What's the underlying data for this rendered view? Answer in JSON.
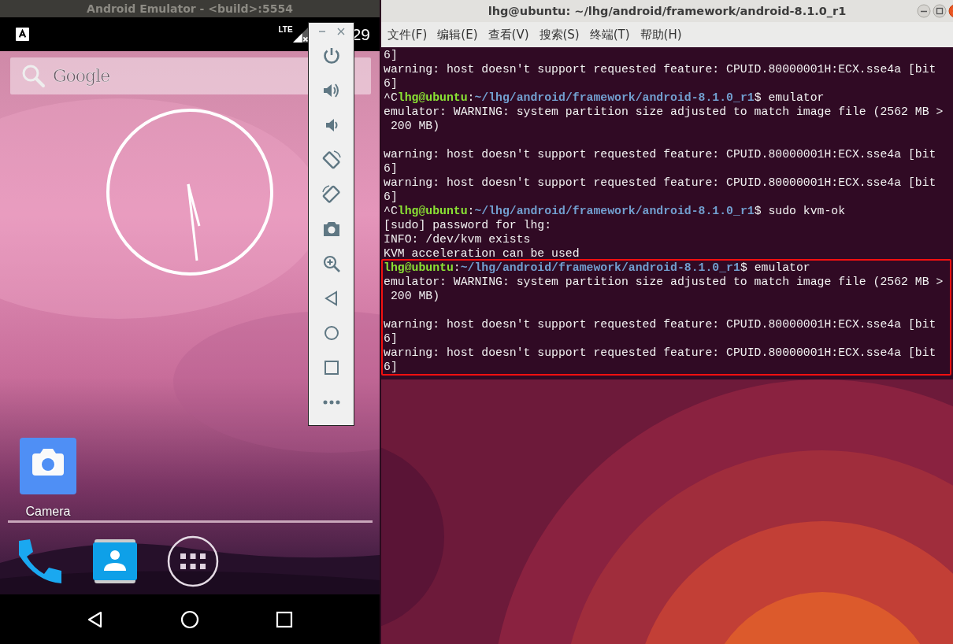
{
  "emulator": {
    "title": "Android Emulator - <build>:5554",
    "status_bar": {
      "network": "LTE",
      "time": "29"
    },
    "search": {
      "logo_text": "Google"
    },
    "apps": [
      {
        "label": "Camera"
      }
    ]
  },
  "terminal": {
    "title": "lhg@ubuntu: ~/lhg/android/framework/android-8.1.0_r1",
    "menu": [
      "文件(F)",
      "编辑(E)",
      "查看(V)",
      "搜索(S)",
      "终端(T)",
      "帮助(H)"
    ],
    "blocks": [
      {
        "highlighted": false,
        "lines": [
          {
            "kind": "output",
            "text": "6]"
          },
          {
            "kind": "output",
            "text": "warning: host doesn't support requested feature: CPUID.80000001H:ECX.sse4a [bit"
          },
          {
            "kind": "output",
            "text": "6]"
          },
          {
            "kind": "prompt",
            "prefix": "^C",
            "user": "lhg@ubuntu",
            "sep": ":",
            "path": "~/lhg/android/framework/android-8.1.0_r1",
            "command": "$ emulator"
          },
          {
            "kind": "output",
            "text": "emulator: WARNING: system partition size adjusted to match image file (2562 MB >"
          },
          {
            "kind": "output",
            "text": " 200 MB)"
          },
          {
            "kind": "blank"
          },
          {
            "kind": "output",
            "text": "warning: host doesn't support requested feature: CPUID.80000001H:ECX.sse4a [bit"
          },
          {
            "kind": "output",
            "text": "6]"
          },
          {
            "kind": "output",
            "text": "warning: host doesn't support requested feature: CPUID.80000001H:ECX.sse4a [bit"
          },
          {
            "kind": "output",
            "text": "6]"
          },
          {
            "kind": "prompt",
            "prefix": "^C",
            "user": "lhg@ubuntu",
            "sep": ":",
            "path": "~/lhg/android/framework/android-8.1.0_r1",
            "command": "$ sudo kvm-ok"
          },
          {
            "kind": "output",
            "text": "[sudo] password for lhg:"
          },
          {
            "kind": "output",
            "text": "INFO: /dev/kvm exists"
          },
          {
            "kind": "output",
            "text": "KVM acceleration can be used"
          }
        ]
      },
      {
        "highlighted": true,
        "lines": [
          {
            "kind": "prompt",
            "user": "lhg@ubuntu",
            "sep": ":",
            "path": "~/lhg/android/framework/android-8.1.0_r1",
            "command": "$ emulator"
          },
          {
            "kind": "output",
            "text": "emulator: WARNING: system partition size adjusted to match image file (2562 MB >"
          },
          {
            "kind": "output",
            "text": " 200 MB)"
          },
          {
            "kind": "blank"
          },
          {
            "kind": "output",
            "text": "warning: host doesn't support requested feature: CPUID.80000001H:ECX.sse4a [bit"
          },
          {
            "kind": "output",
            "text": "6]"
          },
          {
            "kind": "output",
            "text": "warning: host doesn't support requested feature: CPUID.80000001H:ECX.sse4a [bit"
          },
          {
            "kind": "output",
            "text": "6]"
          }
        ]
      }
    ]
  }
}
